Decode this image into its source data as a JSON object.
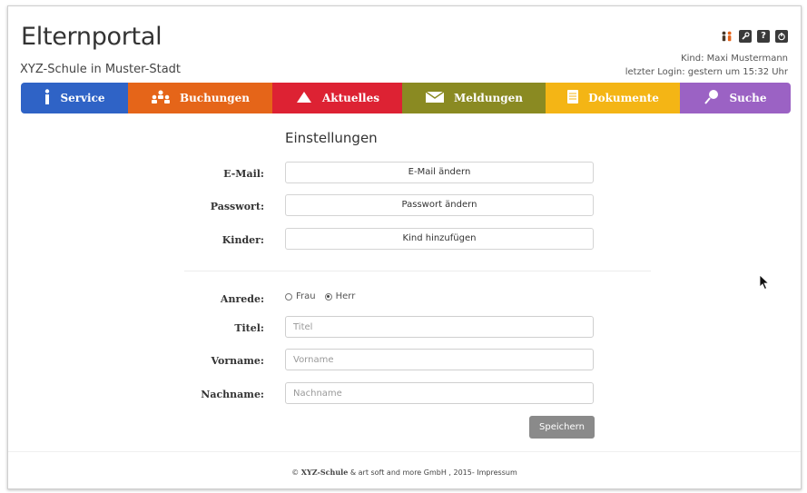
{
  "header": {
    "title": "Elternportal",
    "subtitle": "XYZ-Schule in Muster-Stadt",
    "child_info": "Kind: Maxi Mustermann",
    "last_login": "letzter Login: gestern um 15:32 Uhr",
    "icons": [
      "users-icon",
      "wrench-icon",
      "help-icon",
      "power-icon"
    ]
  },
  "nav": {
    "tabs": [
      {
        "label": "Service",
        "color": "#2f63c6",
        "icon": "info-icon"
      },
      {
        "label": "Buchungen",
        "color": "#e56519",
        "icon": "people-icon"
      },
      {
        "label": "Aktuelles",
        "color": "#dd2233",
        "icon": "megaphone-icon"
      },
      {
        "label": "Meldungen",
        "color": "#8a8a22",
        "icon": "envelope-icon"
      },
      {
        "label": "Dokumente",
        "color": "#f4b515",
        "icon": "document-icon"
      },
      {
        "label": "Suche",
        "color": "#9b62c4",
        "icon": "search-icon"
      }
    ]
  },
  "settings": {
    "title": "Einstellungen",
    "email_label": "E-Mail:",
    "email_button": "E-Mail ändern",
    "password_label": "Passwort:",
    "password_button": "Passwort ändern",
    "children_label": "Kinder:",
    "children_button": "Kind hinzufügen"
  },
  "profile": {
    "salutation_label": "Anrede:",
    "salutation_options": [
      "Frau",
      "Herr"
    ],
    "salutation_selected": "Herr",
    "title_label": "Titel:",
    "title_placeholder": "Titel",
    "firstname_label": "Vorname:",
    "firstname_placeholder": "Vorname",
    "lastname_label": "Nachname:",
    "lastname_placeholder": "Nachname",
    "save_label": "Speichern"
  },
  "footer": {
    "copyright": "©",
    "brand": "XYZ-Schule",
    "text": "& art soft and more GmbH , 2015- Impressum"
  }
}
